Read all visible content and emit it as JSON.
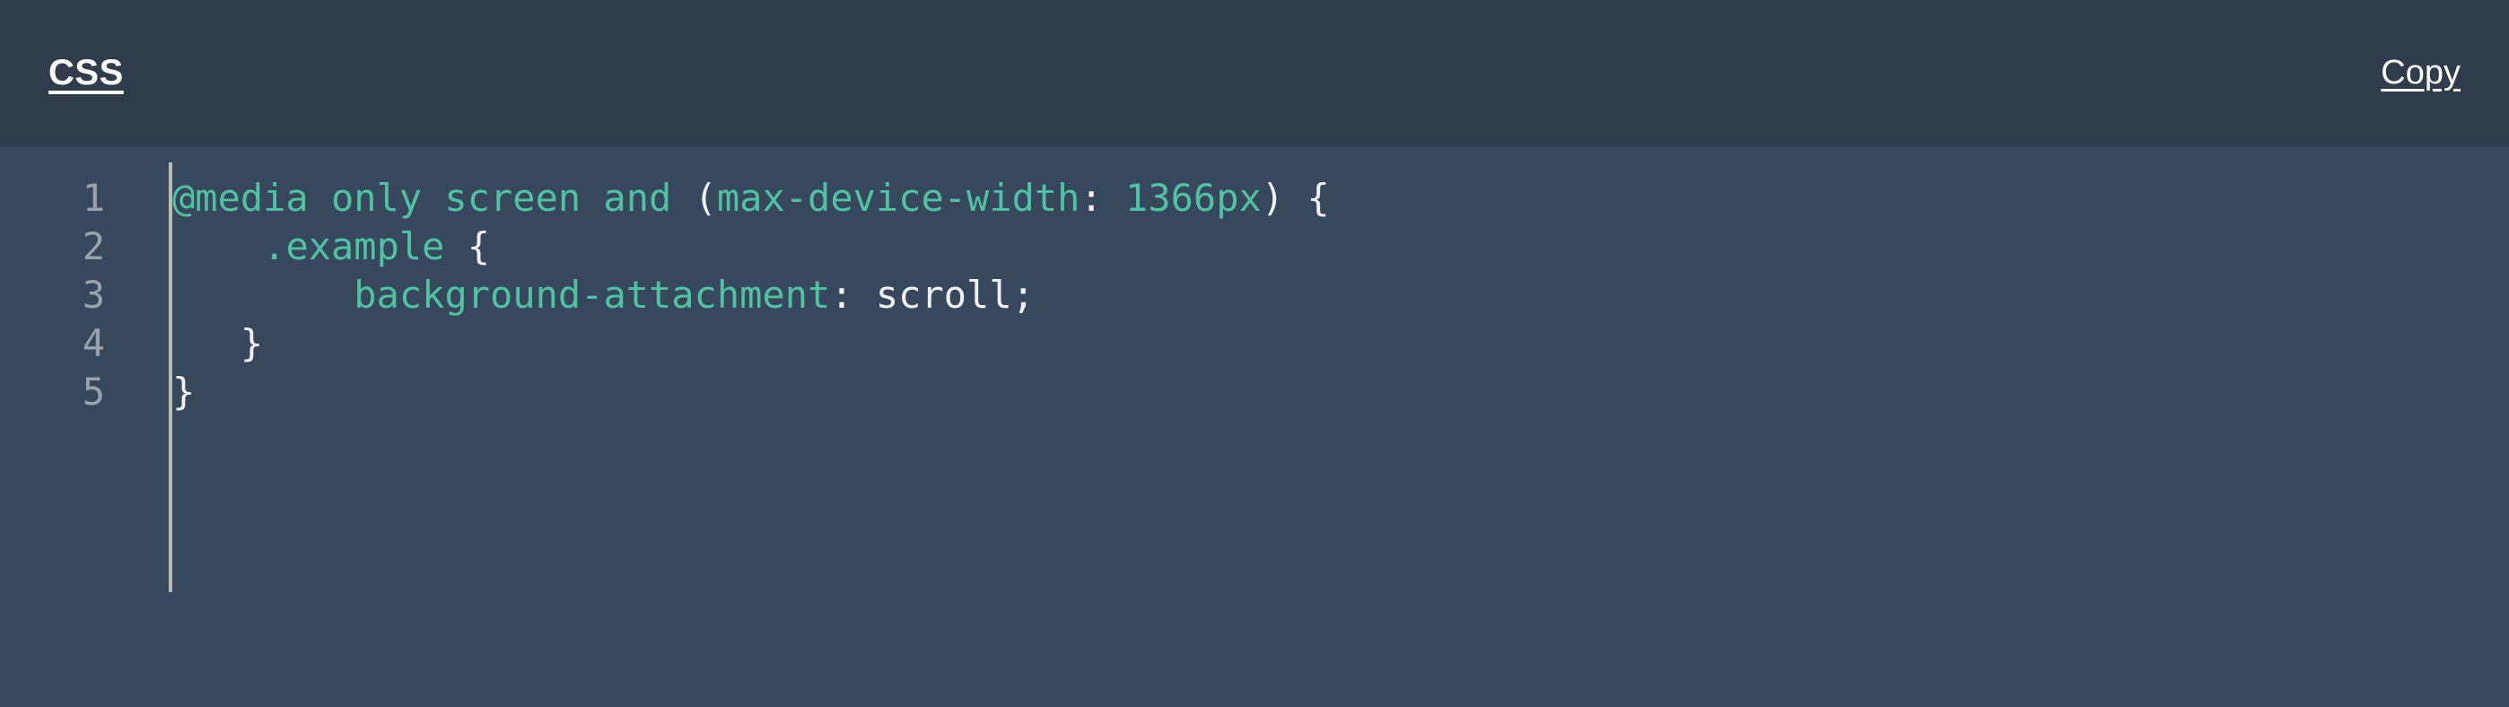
{
  "header": {
    "language_label": "CSS",
    "copy_label": "Copy"
  },
  "colors": {
    "header_background": "#2f3c4c",
    "body_background": "#37475c",
    "gutter_text": "#9aa3ac",
    "gutter_rule": "#b9bcbb",
    "token_green": "#4fc3a1",
    "token_plain": "#eef1f5",
    "header_text": "#ffffff"
  },
  "code": {
    "language": "css",
    "plain_text": "@media only screen and (max-device-width: 1366px) {\n    .example {\n        background-attachment: scroll;\n    }\n}",
    "lines": [
      {
        "number": "1",
        "text": "@media only screen and (max-device-width: 1366px) {",
        "tokens": [
          {
            "t": "@media only screen and ",
            "c": "green"
          },
          {
            "t": "(",
            "c": "plain"
          },
          {
            "t": "max-device-width",
            "c": "green"
          },
          {
            "t": ": ",
            "c": "plain"
          },
          {
            "t": "1366px",
            "c": "green"
          },
          {
            "t": ") {",
            "c": "plain"
          }
        ]
      },
      {
        "number": "2",
        "text": "    .example {",
        "tokens": [
          {
            "t": "    ",
            "c": "plain"
          },
          {
            "t": ".example",
            "c": "green"
          },
          {
            "t": " {",
            "c": "plain"
          }
        ]
      },
      {
        "number": "3",
        "text": "        background-attachment: scroll;",
        "tokens": [
          {
            "t": "        ",
            "c": "plain"
          },
          {
            "t": "background-attachment",
            "c": "green"
          },
          {
            "t": ": ",
            "c": "plain"
          },
          {
            "t": "scroll;",
            "c": "plain"
          }
        ]
      },
      {
        "number": "4",
        "text": "   }",
        "tokens": [
          {
            "t": "   }",
            "c": "plain"
          }
        ]
      },
      {
        "number": "5",
        "text": "}",
        "tokens": [
          {
            "t": "}",
            "c": "plain"
          }
        ]
      }
    ]
  }
}
